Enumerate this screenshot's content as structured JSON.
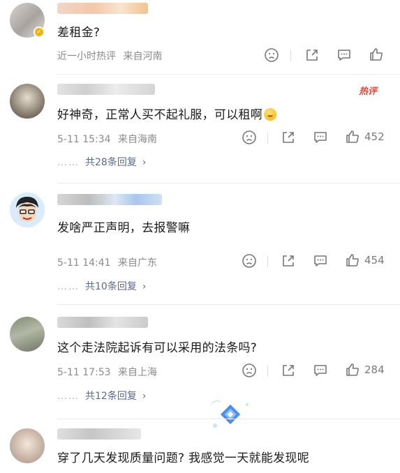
{
  "comments": [
    {
      "text": "差租金?",
      "time": "近一小时热评",
      "location": "来自河南",
      "likes": "",
      "replies": ""
    },
    {
      "hot_badge": "热评",
      "text": "好神奇，正常人买不起礼服，可以租啊",
      "time": "5-11 15:34",
      "location": "来自海南",
      "likes": "452",
      "replies_dots": "……",
      "replies": "共28条回复"
    },
    {
      "text": "发啥严正声明，去报警嘛",
      "time": "5-11 14:41",
      "location": "来自广东",
      "likes": "454",
      "replies_dots": "……",
      "replies": "共10条回复"
    },
    {
      "text": "这个走法院起诉有可以采用的法条吗?",
      "time": "5-11 17:53",
      "location": "来自上海",
      "likes": "284",
      "replies_dots": "……",
      "replies": "共12条回复"
    },
    {
      "text": "穿了几天发现质量问题? 我感觉一天就能发现呢"
    }
  ],
  "icons": {
    "dislike": "frown-icon",
    "share": "share-icon",
    "comment": "comment-icon",
    "like": "thumbs-up-icon",
    "reply_chevron": "chevron-right-icon"
  },
  "colors": {
    "hot": "#e8493d",
    "reply_link": "#5b6a8c",
    "meta": "#8a8a8a",
    "verified": "#f5b400"
  }
}
